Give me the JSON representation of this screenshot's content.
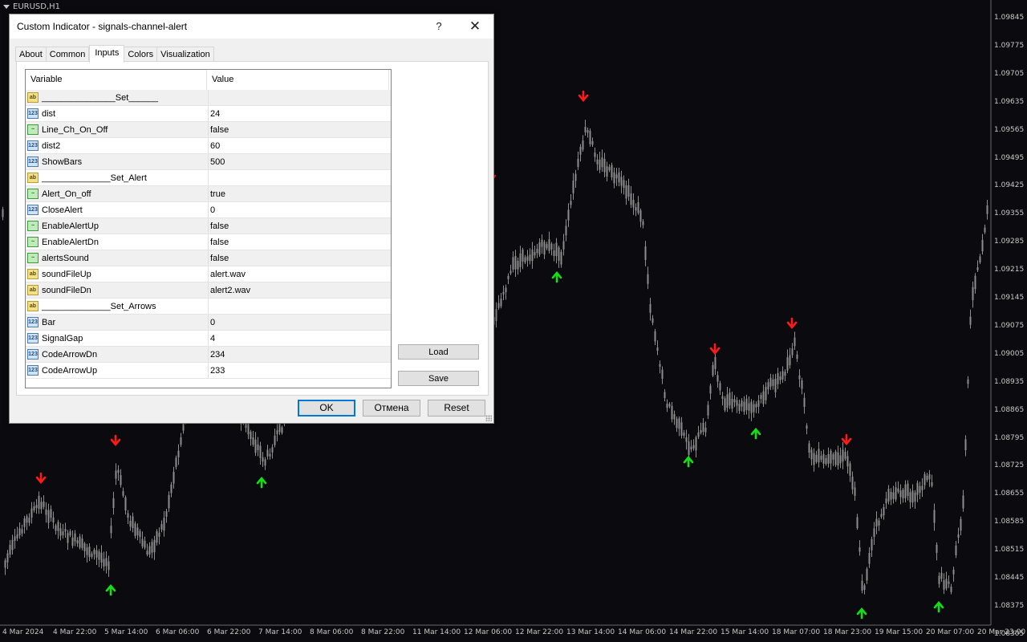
{
  "chart": {
    "symbol": "EURUSD,H1",
    "colors": {
      "background": "#0b0b0f",
      "candle": "#8e8e8e",
      "arrow_up": "#12e012",
      "arrow_down": "#ff1a1a",
      "axis_text": "#c8c8c8"
    },
    "price_labels": [
      "1.09845",
      "1.09775",
      "1.09705",
      "1.09635",
      "1.09565",
      "1.09495",
      "1.09425",
      "1.09355",
      "1.09285",
      "1.09215",
      "1.09145",
      "1.09075",
      "1.09005",
      "1.08935",
      "1.08865",
      "1.08795",
      "1.08725",
      "1.08655",
      "1.08585",
      "1.08515",
      "1.08445",
      "1.08375",
      "1.08305"
    ],
    "time_labels": [
      "4 Mar 2024",
      "4 Mar 22:00",
      "5 Mar 14:00",
      "6 Mar 06:00",
      "6 Mar 22:00",
      "7 Mar 14:00",
      "8 Mar 06:00",
      "8 Mar 22:00",
      "11 Mar 14:00",
      "12 Mar 06:00",
      "12 Mar 22:00",
      "13 Mar 14:00",
      "14 Mar 06:00",
      "14 Mar 22:00",
      "15 Mar 14:00",
      "18 Mar 07:00",
      "18 Mar 23:00",
      "19 Mar 15:00",
      "20 Mar 07:00",
      "20 Mar 23:00"
    ]
  },
  "dialog": {
    "title": "Custom Indicator - signals-channel-alert",
    "help_label": "?",
    "close_label": "✕",
    "tabs": [
      "About",
      "Common",
      "Inputs",
      "Colors",
      "Visualization"
    ],
    "active_tab": "Inputs",
    "columns": {
      "variable": "Variable",
      "value": "Value"
    },
    "inputs": [
      {
        "type": "ab",
        "name": "_______________Set______",
        "value": ""
      },
      {
        "type": "num",
        "name": "dist",
        "value": "24"
      },
      {
        "type": "bool",
        "name": "Line_Ch_On_Off",
        "value": "false"
      },
      {
        "type": "num",
        "name": "dist2",
        "value": "60"
      },
      {
        "type": "num",
        "name": "ShowBars",
        "value": "500"
      },
      {
        "type": "ab",
        "name": "______________Set_Alert",
        "value": ""
      },
      {
        "type": "bool",
        "name": "Alert_On_off",
        "value": "true"
      },
      {
        "type": "num",
        "name": "CloseAlert",
        "value": "0"
      },
      {
        "type": "bool",
        "name": "EnableAlertUp",
        "value": "false"
      },
      {
        "type": "bool",
        "name": "EnableAlertDn",
        "value": "false"
      },
      {
        "type": "bool",
        "name": "alertsSound",
        "value": "false"
      },
      {
        "type": "ab",
        "name": "soundFileUp",
        "value": "alert.wav"
      },
      {
        "type": "ab",
        "name": "soundFileDn",
        "value": "alert2.wav"
      },
      {
        "type": "ab",
        "name": "______________Set_Arrows",
        "value": ""
      },
      {
        "type": "num",
        "name": "Bar",
        "value": "0"
      },
      {
        "type": "num",
        "name": "SignalGap",
        "value": "4"
      },
      {
        "type": "num",
        "name": "CodeArrowDn",
        "value": "234"
      },
      {
        "type": "num",
        "name": "CodeArrowUp",
        "value": "233"
      }
    ],
    "icon_text": {
      "ab": "ab",
      "num": "123",
      "bool": "~"
    },
    "load_label": "Load",
    "save_label": "Save",
    "ok_label": "OK",
    "cancel_label": "Отмена",
    "reset_label": "Reset"
  }
}
